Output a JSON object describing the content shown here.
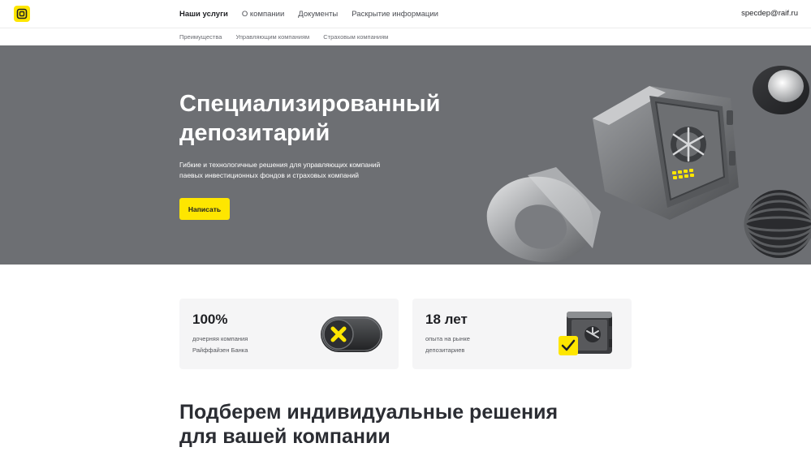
{
  "header": {
    "logo_icon": "raiffeisen-logo-icon",
    "nav": [
      {
        "label": "Наши услуги",
        "active": true
      },
      {
        "label": "О компании",
        "active": false
      },
      {
        "label": "Документы",
        "active": false
      },
      {
        "label": "Раскрытие информации",
        "active": false
      }
    ],
    "email": "specdep@raif.ru"
  },
  "subnav": [
    "Преимущества",
    "Управляющим компаниям",
    "Страховым компаниям"
  ],
  "hero": {
    "title_line1": "Специализированный",
    "title_line2": "депозитарий",
    "subtitle_line1": "Гибкие и технологичные решения для управляющих компаний",
    "subtitle_line2": "паевых инвестиционных фондов и страховых компаний",
    "button_label": "Написать",
    "art": "safe-illustration"
  },
  "cards": [
    {
      "value": "100%",
      "desc_line1": "дочерняя компания",
      "desc_line2": "Райффайзен Банка",
      "icon": "toggle-x-icon"
    },
    {
      "value": "18 лет",
      "desc_line1": "опыта на рынке",
      "desc_line2": "депозитариев",
      "icon": "safe-check-icon"
    }
  ],
  "section": {
    "title_line1": "Подберем индивидуальные решения",
    "title_line2": "для вашей компании"
  },
  "colors": {
    "brand_yellow": "#fee600",
    "hero_bg": "#6d6f73",
    "card_bg": "#f5f5f6",
    "text_dark": "#2b2d33"
  }
}
